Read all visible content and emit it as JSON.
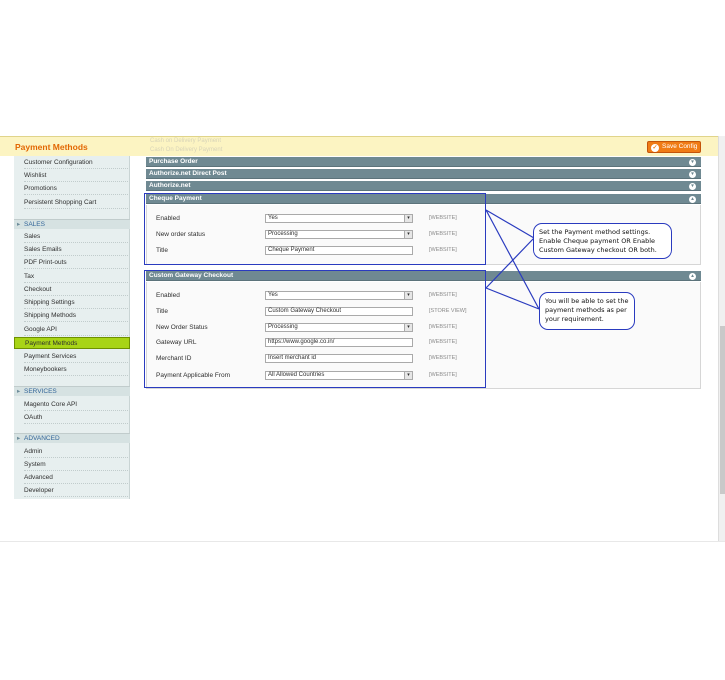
{
  "header": {
    "title": "Payment Methods",
    "ghost_line1": "Cash on Delivery Payment",
    "ghost_line2": "Cash On Delivery Payment",
    "save_label": "Save Config"
  },
  "sidebar": {
    "items_top": [
      "Customer Configuration",
      "Wishlist",
      "Promotions",
      "Persistent Shopping Cart"
    ],
    "group_sales": "SALES",
    "items_sales": [
      "Sales",
      "Sales Emails",
      "PDF Print-outs",
      "Tax",
      "Checkout",
      "Shipping Settings",
      "Shipping Methods",
      "Google API",
      "Payment Methods",
      "Payment Services",
      "Moneybookers"
    ],
    "active_item": "Payment Methods",
    "group_services": "SERVICES",
    "items_services": [
      "Magento Core API",
      "OAuth"
    ],
    "group_advanced": "ADVANCED",
    "items_advanced": [
      "Admin",
      "System",
      "Advanced",
      "Developer"
    ]
  },
  "sections": {
    "purchase_order": "Purchase Order",
    "authorize_direct_post": "Authorize.net Direct Post",
    "authorize_net": "Authorize.net",
    "cheque": "Cheque Payment",
    "custom_gateway": "Custom Gateway Checkout"
  },
  "cheque": {
    "enabled_label": "Enabled",
    "enabled_value": "Yes",
    "enabled_scope": "[WEBSITE]",
    "status_label": "New order status",
    "status_value": "Processing",
    "status_scope": "[WEBSITE]",
    "title_label": "Title",
    "title_value": "Cheque Payment",
    "title_scope": "[WEBSITE]"
  },
  "gateway": {
    "enabled_label": "Enabled",
    "enabled_value": "Yes",
    "enabled_scope": "[WEBSITE]",
    "title_label": "Title",
    "title_value": "Custom Gateway Checkout",
    "title_scope": "[STORE VIEW]",
    "status_label": "New Order Status",
    "status_value": "Processing",
    "status_scope": "[WEBSITE]",
    "url_label": "Gateway URL",
    "url_value": "https://www.google.co.in/",
    "url_scope": "[WEBSITE]",
    "merchant_label": "Merchant ID",
    "merchant_value": "Insert merchant id",
    "merchant_scope": "[WEBSITE]",
    "countries_label": "Payment Applicable From",
    "countries_value": "All Allowed Countries",
    "countries_scope": "[WEBSITE]"
  },
  "callouts": {
    "first": "Set the Payment method settings. Enable Cheque payment OR Enable Custom Gateway checkout OR both.",
    "second": "You will be able to set the payment methods as per your requirement."
  },
  "colors": {
    "accent": "#f07c15",
    "active_nav": "#a8d416",
    "section_bar": "#6f8992",
    "annotation": "#2a3bbf"
  }
}
